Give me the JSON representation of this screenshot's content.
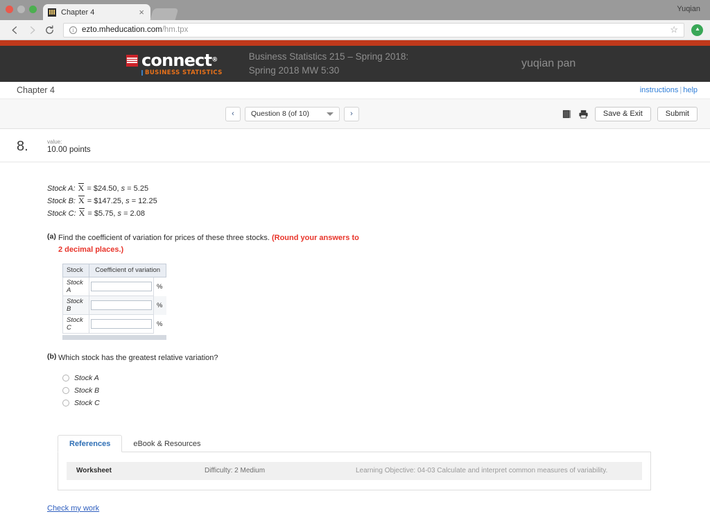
{
  "browser": {
    "tab_title": "Chapter 4",
    "tab_favicon": "book-favicon",
    "close_label": "×",
    "profile_name": "Yuqian",
    "url_host": "ezto.mheducation.com",
    "url_path": "/hm.tpx",
    "back_icon": "back-arrow-icon",
    "forward_icon": "forward-arrow-icon",
    "reload_icon": "reload-icon",
    "info_icon": "ⓘ",
    "star_icon": "☆",
    "extension_icon": "extension-icon"
  },
  "header": {
    "logo_word": "connect",
    "logo_trademark": "®",
    "logo_subtitle": "BUSINESS STATISTICS",
    "course_title": "Business Statistics 215 – Spring 2018: Spring 2018 MW 5:30",
    "user_name": "yuqian pan",
    "background": "#333333",
    "accent_band": "#c0391b"
  },
  "chapter_bar": {
    "chapter": "Chapter 4",
    "instructions_link": "instructions",
    "separator": "|",
    "help_link": "help"
  },
  "toolbar": {
    "prev_label": "‹",
    "next_label": "›",
    "question_selector": "Question 8 (of 10)",
    "book_icon": "book-icon",
    "print_icon": "print-icon",
    "save_exit_label": "Save & Exit",
    "submit_label": "Submit"
  },
  "question": {
    "number": "8.",
    "value_label": "value:",
    "value": "10.00 points",
    "stocks": [
      {
        "name": "Stock A:",
        "mean_symbol": "X",
        "mean": "= $24.50,",
        "s_symbol": "s",
        "s": "= 5.25"
      },
      {
        "name": "Stock B:",
        "mean_symbol": "X",
        "mean": "= $147.25,",
        "s_symbol": "s",
        "s": "= 12.25"
      },
      {
        "name": "Stock C:",
        "mean_symbol": "X",
        "mean": "= $5.75,",
        "s_symbol": "s",
        "s": "= 2.08"
      }
    ],
    "part_a": {
      "label": "(a)",
      "text": "Find the coefficient of variation for prices of these three stocks.",
      "note": "(Round your answers to 2 decimal places.)",
      "table": {
        "headers": [
          "Stock",
          "Coefficient of variation"
        ],
        "rows": [
          {
            "stock": "Stock A",
            "value": "",
            "unit": "%"
          },
          {
            "stock": "Stock B",
            "value": "",
            "unit": "%"
          },
          {
            "stock": "Stock C",
            "value": "",
            "unit": "%"
          }
        ]
      }
    },
    "part_b": {
      "label": "(b)",
      "text": "Which stock has the greatest relative variation?",
      "options": [
        "Stock A",
        "Stock B",
        "Stock C"
      ],
      "selected": null
    }
  },
  "tabs": [
    {
      "label": "References",
      "active": true
    },
    {
      "label": "eBook & Resources",
      "active": false
    }
  ],
  "worksheet": {
    "title": "Worksheet",
    "difficulty": "Difficulty: 2 Medium",
    "learning_objective": "Learning Objective: 04-03 Calculate and interpret common measures of variability."
  },
  "footer": {
    "check_work_link": "Check my work"
  }
}
